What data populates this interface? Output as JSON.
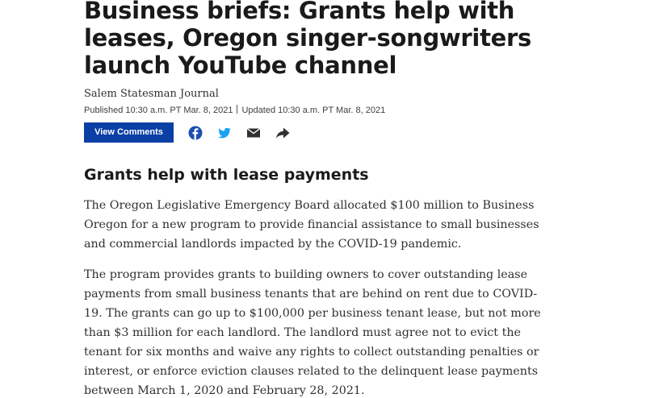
{
  "article": {
    "headline": "Business briefs: Grants help with leases, Oregon singer-songwriters launch YouTube channel",
    "byline": "Salem Statesman Journal",
    "published": "Published 10:30 a.m. PT Mar. 8, 2021",
    "updated": "Updated 10:30 a.m. PT Mar. 8, 2021"
  },
  "actions": {
    "comments_label": "View Comments",
    "icons": [
      "facebook-icon",
      "twitter-icon",
      "email-icon",
      "share-icon"
    ]
  },
  "section": {
    "heading": "Grants help with lease payments",
    "paragraphs": [
      "The Oregon Legislative Emergency Board allocated $100 million to Business Oregon for a new program to provide financial assistance to small businesses and commercial landlords impacted by the COVID-19 pandemic.",
      "The program provides grants to building owners to cover outstanding lease payments from small business tenants that are behind on rent due to COVID-19. The grants can go up to $100,000 per business tenant lease, but not more than $3 million for each landlord. The landlord must agree not to evict the tenant for six months and waive any rights to collect outstanding penalties or interest, or enforce eviction clauses related to the delinquent lease payments between March 1, 2020 and February 28, 2021."
    ]
  },
  "colors": {
    "button_bg": "#0a3fa6",
    "facebook": "#1b4fb0",
    "twitter": "#1da1f2",
    "icon_dark": "#303030"
  }
}
